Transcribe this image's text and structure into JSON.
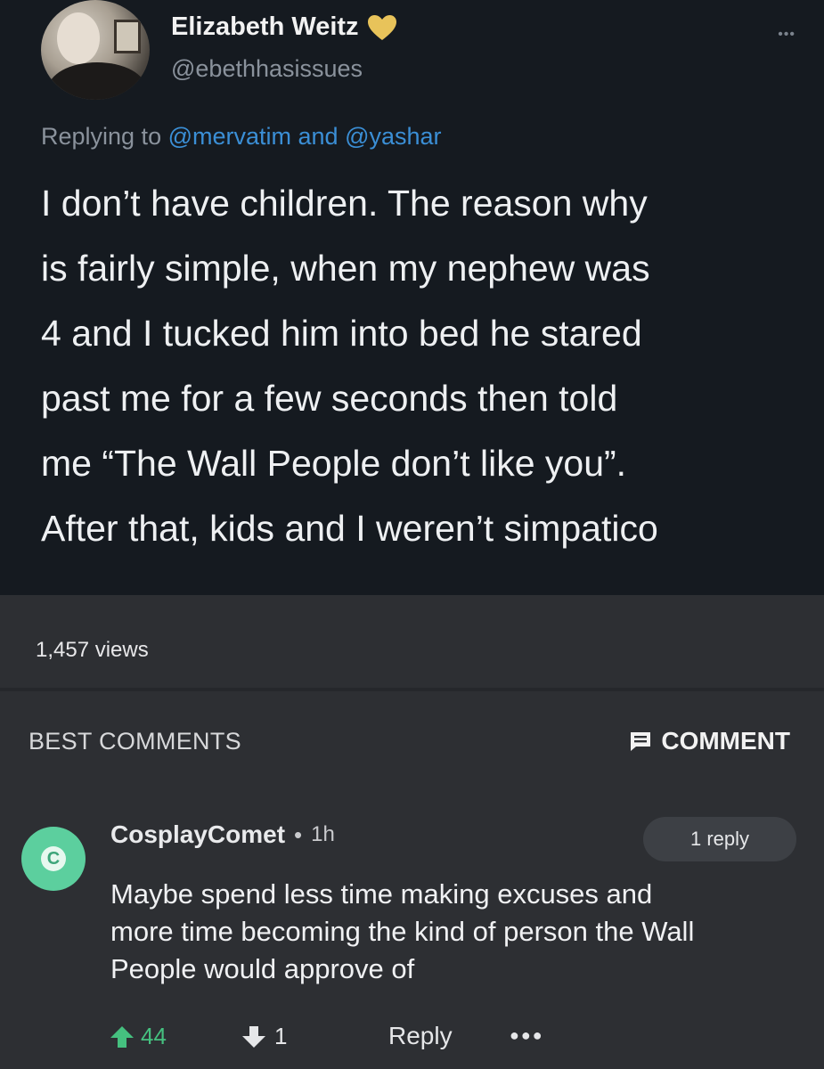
{
  "tweet": {
    "author_name": "Elizabeth Weitz",
    "author_handle": "@ebethhasissues",
    "replying_prefix": "Replying to ",
    "mention_1": "@mervatim",
    "replying_and": " and ",
    "mention_2": "@yashar",
    "body_lines": [
      "I don’t have children. The reason why",
      "is fairly simple, when my nephew was",
      "4 and I tucked him into bed he stared",
      "past me for a few seconds then told",
      "me “The Wall People don’t like you”.",
      "After that, kids and I weren’t simpatico"
    ],
    "views": "1,457 views",
    "heart_color": "#e8c35a"
  },
  "comments_section": {
    "header": "BEST COMMENTS",
    "comment_button": "COMMENT"
  },
  "comment": {
    "avatar_letter": "C",
    "avatar_color": "#5ccf9e",
    "username": "CosplayComet",
    "separator": "•",
    "time": "1h",
    "reply_count": "1 reply",
    "body_lines": [
      "Maybe spend less time making excuses and",
      "more time becoming the kind of person the Wall",
      "People would approve of"
    ],
    "upvotes": "44",
    "downvotes": "1",
    "reply_label": "Reply",
    "upvote_color": "#45c07f"
  }
}
